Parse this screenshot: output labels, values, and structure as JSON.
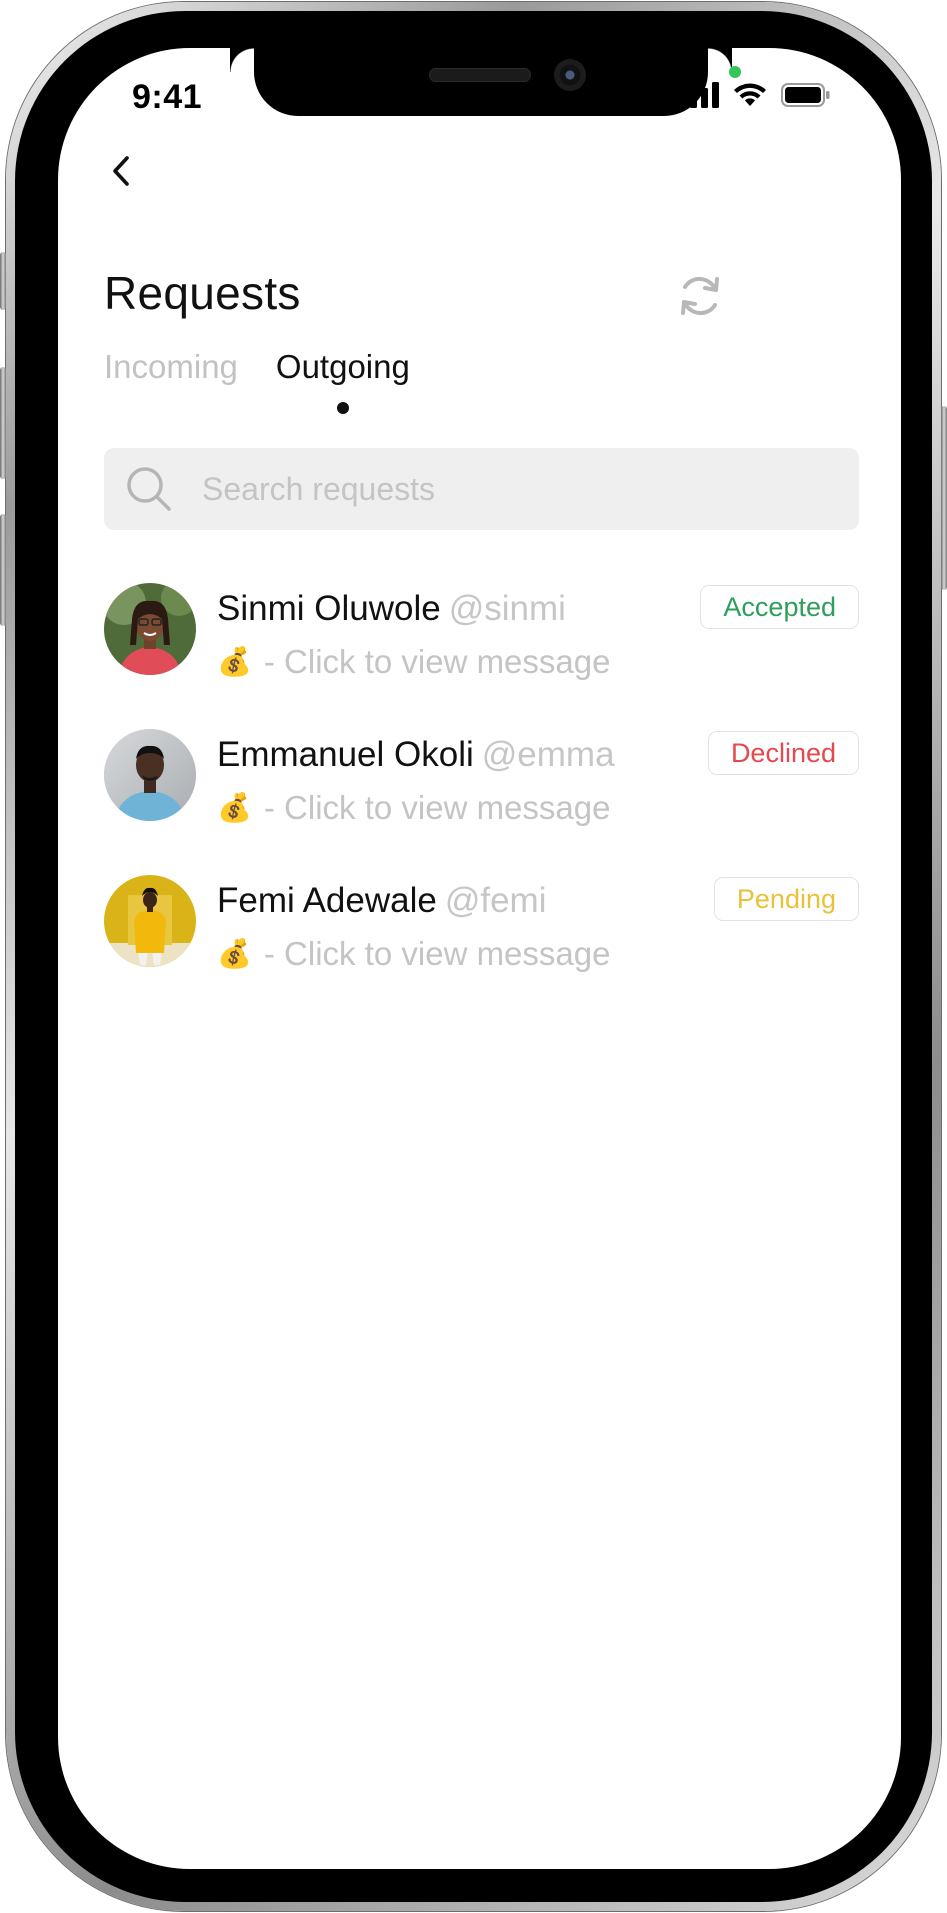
{
  "status_bar": {
    "time": "9:41"
  },
  "header": {
    "title": "Requests"
  },
  "tabs": [
    {
      "label": "Incoming",
      "active": false
    },
    {
      "label": "Outgoing",
      "active": true
    }
  ],
  "search": {
    "placeholder": "Search requests",
    "value": ""
  },
  "requests": [
    {
      "name": "Sinmi Oluwole",
      "handle": "@sinmi",
      "message": "- Click to view message",
      "status": "Accepted",
      "status_color": "#2e9e5b",
      "avatar": "woman-with-glasses-photo"
    },
    {
      "name": "Emmanuel Okoli",
      "handle": "@emma",
      "message": "- Click to view message",
      "status": "Declined",
      "status_color": "#e5484d",
      "avatar": "man-in-blue-shirt-photo"
    },
    {
      "name": "Femi Adewale",
      "handle": "@femi",
      "message": "- Click to view message",
      "status": "Pending",
      "status_color": "#e8c23a",
      "avatar": "person-yellow-background-photo"
    }
  ],
  "icons": {
    "message_icon": "money-bag-icon",
    "money_glyph": "💰"
  },
  "colors": {
    "accepted": "#2e9e5b",
    "declined": "#e5484d",
    "pending": "#e8c23a",
    "search_bg": "#efefef"
  }
}
